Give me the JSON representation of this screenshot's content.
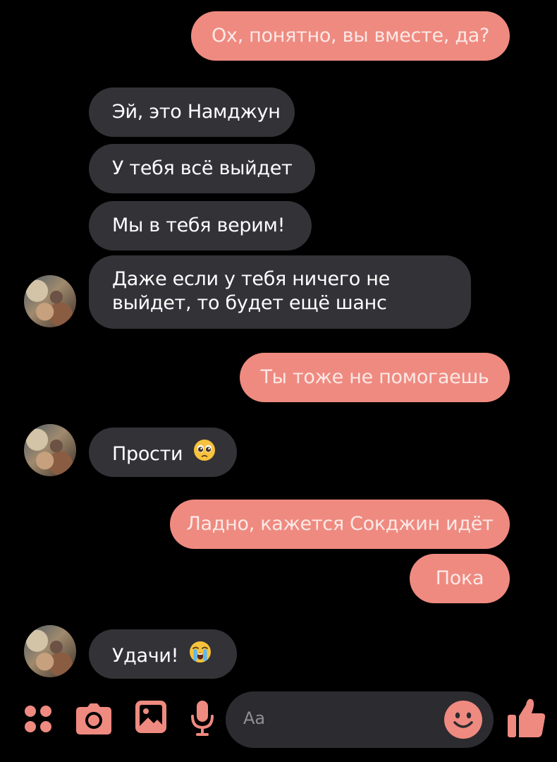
{
  "messages": [
    {
      "side": "out",
      "text": "Ох, понятно, вы вместе, да?"
    },
    {
      "side": "in",
      "text": "Эй, это Намджун"
    },
    {
      "side": "in",
      "text": "У тебя всё выйдет"
    },
    {
      "side": "in",
      "text": "Мы в тебя верим!"
    },
    {
      "side": "in",
      "line1": "Даже если у тебя ничего не",
      "line2": "выйдет, то будет ещё шанс"
    },
    {
      "side": "out",
      "text": "Ты тоже не помогаешь"
    },
    {
      "side": "in",
      "text": "Прости",
      "emoji": "pleading-face-emoji"
    },
    {
      "side": "out",
      "text": "Ладно, кажется Сокджин идёт"
    },
    {
      "side": "out",
      "text": "Пока"
    },
    {
      "side": "in",
      "text": "Удачи!",
      "emoji": "crying-face-emoji"
    }
  ],
  "composer": {
    "placeholder": "Aa",
    "icons": [
      "menu-dots-icon",
      "camera-icon",
      "image-icon",
      "microphone-icon",
      "smile-icon",
      "thumbs-up-icon"
    ]
  },
  "colors": {
    "background": "#000000",
    "incoming_bubble": "#333237",
    "outgoing_bubble": "#ef8a80",
    "accent": "#ef8a80",
    "input_bg": "#2c2b30"
  }
}
